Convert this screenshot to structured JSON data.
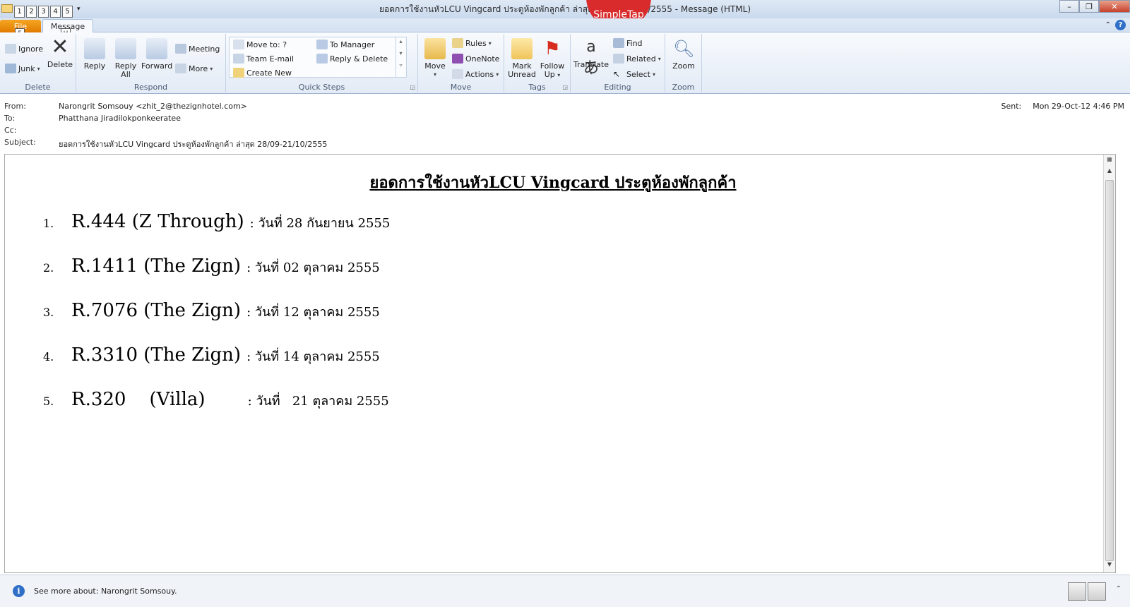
{
  "window": {
    "title": "ยอดการใช้งานหัวLCU Vingcard ประตูห้องพักลูกค้า ล่าสุด 28/09-21/10/2555  -  Message (HTML)",
    "overlay_badge": "SimpleTap",
    "quick_access_keytips": [
      "1",
      "2",
      "3",
      "4",
      "5"
    ]
  },
  "tabs": {
    "file": "File",
    "message": "Message",
    "file_keytip": "F",
    "message_keytip": "H"
  },
  "ribbon": {
    "delete_group": {
      "label": "Delete",
      "ignore": "Ignore",
      "junk": "Junk",
      "delete": "Delete"
    },
    "respond_group": {
      "label": "Respond",
      "reply": "Reply",
      "reply_all_1": "Reply",
      "reply_all_2": "All",
      "forward": "Forward",
      "meeting": "Meeting",
      "more": "More"
    },
    "quick_steps_group": {
      "label": "Quick Steps",
      "move_to": "Move to: ?",
      "team_email": "Team E-mail",
      "create_new": "Create New",
      "to_manager": "To Manager",
      "reply_delete": "Reply & Delete"
    },
    "move_group": {
      "label": "Move",
      "move": "Move",
      "rules": "Rules",
      "onenote": "OneNote",
      "actions": "Actions"
    },
    "tags_group": {
      "label": "Tags",
      "mark_unread_1": "Mark",
      "mark_unread_2": "Unread",
      "follow_up_1": "Follow",
      "follow_up_2": "Up"
    },
    "editing_group": {
      "label": "Editing",
      "translate": "Translate",
      "find": "Find",
      "related": "Related",
      "select": "Select"
    },
    "zoom_group": {
      "label": "Zoom",
      "zoom": "Zoom"
    }
  },
  "header": {
    "from_label": "From:",
    "from_value": "Narongrit Somsouy <zhit_2@thezignhotel.com>",
    "to_label": "To:",
    "to_value": "Phatthana Jiradilokponkeeratee",
    "cc_label": "Cc:",
    "cc_value": "",
    "subject_label": "Subject:",
    "subject_value": "ยอดการใช้งานหัวLCU Vingcard ประตูห้องพักลูกค้า ล่าสุด 28/09-21/10/2555",
    "sent_label": "Sent:",
    "sent_value": "Mon 29-Oct-12 4:46 PM"
  },
  "body": {
    "title": "ยอดการใช้งานหัวLCU Vingcard  ประตูห้องพักลูกค้า",
    "items": [
      {
        "num": "1.",
        "room": "R.444 (Z Through)",
        "date": ": วันที่ 28 กันยายน 2555"
      },
      {
        "num": "2.",
        "room": "R.1411 (The Zign)",
        "date": ": วันที่ 02 ตุลาคม 2555"
      },
      {
        "num": "3.",
        "room": "R.7076 (The Zign)",
        "date": ": วันที่ 12 ตุลาคม 2555"
      },
      {
        "num": "4.",
        "room": "R.3310 (The Zign)",
        "date": ": วันที่ 14 ตุลาคม 2555"
      },
      {
        "num": "5.",
        "room": "R.320    (Villa)",
        "date": ": วันที่   21 ตุลาคม 2555"
      }
    ]
  },
  "status": {
    "text": "See more about: Narongrit Somsouy."
  }
}
